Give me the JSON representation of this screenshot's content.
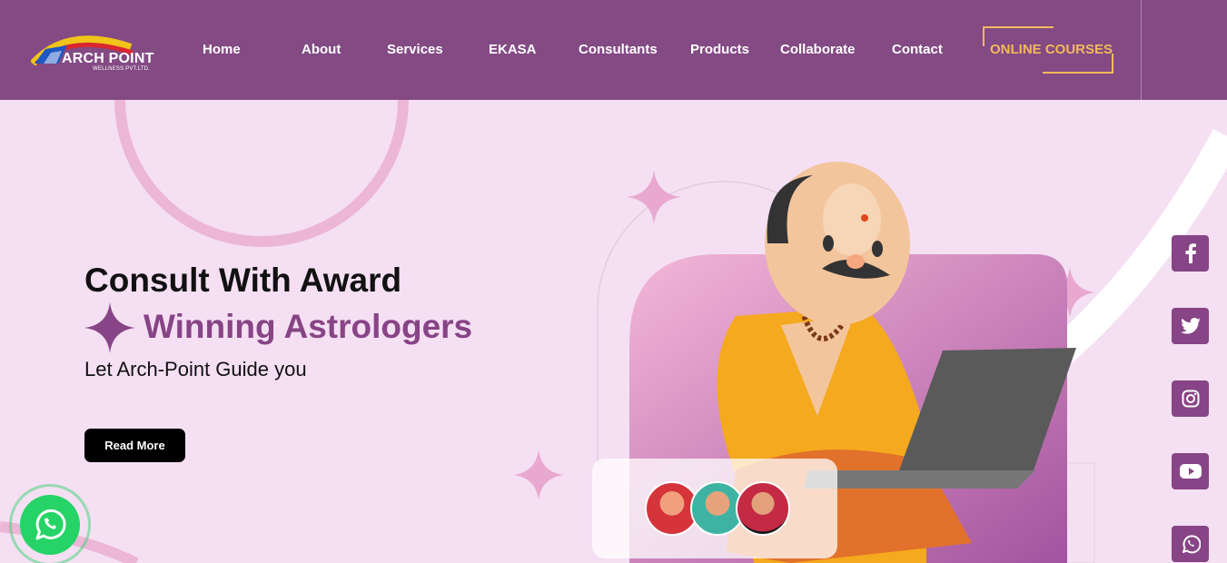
{
  "brand": {
    "name": "ARCH POINT",
    "tagline": "WELLNESS PVT.LTD."
  },
  "nav": {
    "items": [
      {
        "label": "Home"
      },
      {
        "label": "About"
      },
      {
        "label": "Services"
      },
      {
        "label": "EKASA"
      },
      {
        "label": "Consultants"
      },
      {
        "label": "Products"
      },
      {
        "label": "Collaborate"
      },
      {
        "label": "Contact"
      }
    ],
    "cta": "ONLINE COURSES"
  },
  "hero": {
    "title_line1": "Consult With Award",
    "title_line2": "Winning Astrologers",
    "subtitle": "Let Arch-Point Guide you",
    "button": "Read More"
  },
  "social": [
    "facebook-icon",
    "twitter-icon",
    "instagram-icon",
    "youtube-icon",
    "whatsapp-icon"
  ],
  "colors": {
    "brand_purple": "#834a84",
    "accent_purple": "#874486",
    "cta_gold": "#f3b95b",
    "background": "#f5dff3",
    "whatsapp": "#25d366"
  }
}
